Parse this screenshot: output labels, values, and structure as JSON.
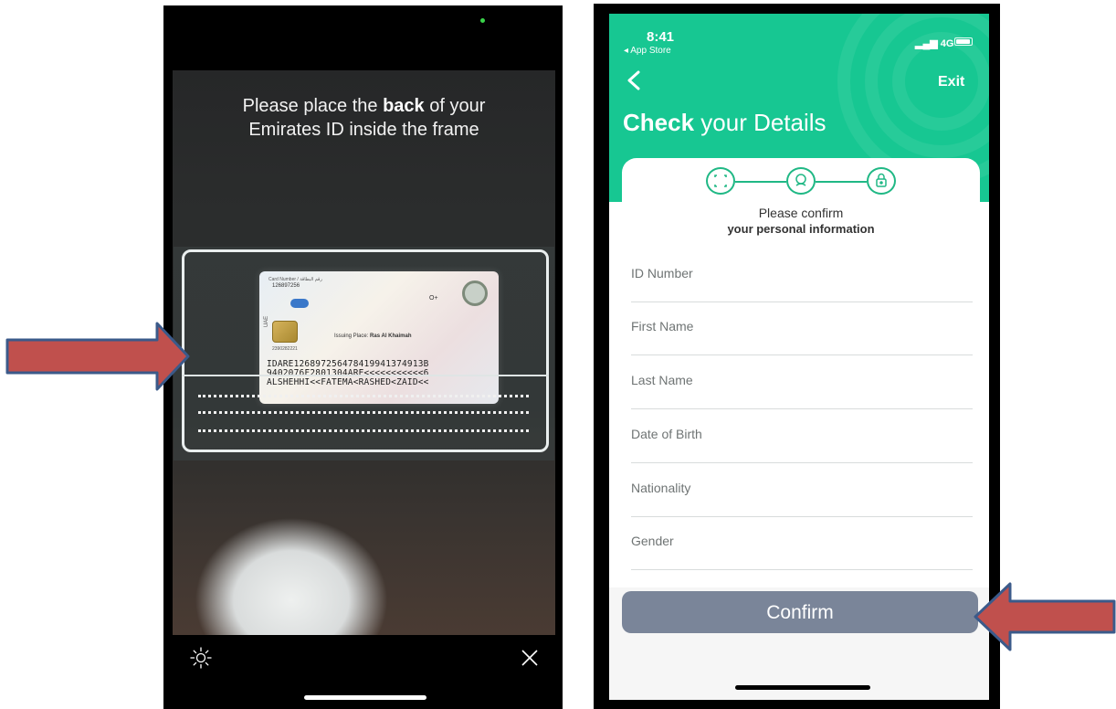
{
  "left_screen": {
    "instruction_before": "Please place the ",
    "instruction_bold": "back",
    "instruction_after": " of your",
    "instruction_line2": "Emirates ID inside the frame",
    "card": {
      "card_number_label": "Card Number / رقم البطاقة",
      "card_number": "126897256",
      "issuing_place_label": "Issuing Place:",
      "issuing_place": "Ras Al Khaimah",
      "blood_group": "O+",
      "side_code": "UAE",
      "serial": "2390282221",
      "mrz_line1": "IDARE126897256478419941374913B",
      "mrz_line2": "9402076F2801304ARE<<<<<<<<<<<6",
      "mrz_line3": "ALSHEHHI<<FATEMA<RASHED<ZAID<<"
    },
    "icons": {
      "flash": "flash-icon",
      "close": "close-icon"
    }
  },
  "right_screen": {
    "status": {
      "time": "8:41",
      "back_app": "◂ App Store",
      "network": "4G"
    },
    "header": {
      "exit_label": "Exit",
      "title_bold": "Check",
      "title_rest": " your Details"
    },
    "stepper": [
      "scan-step-icon",
      "face-step-icon",
      "lock-step-icon"
    ],
    "prompt_line1": "Please confirm",
    "prompt_line2": "your personal information",
    "fields": [
      {
        "label": "ID Number"
      },
      {
        "label": "First Name"
      },
      {
        "label": "Last Name"
      },
      {
        "label": "Date of Birth"
      },
      {
        "label": "Nationality"
      },
      {
        "label": "Gender"
      }
    ],
    "confirm_label": "Confirm",
    "colors": {
      "brand_green": "#17c792",
      "button": "#7a8599",
      "arrow": "#c0504d"
    }
  }
}
